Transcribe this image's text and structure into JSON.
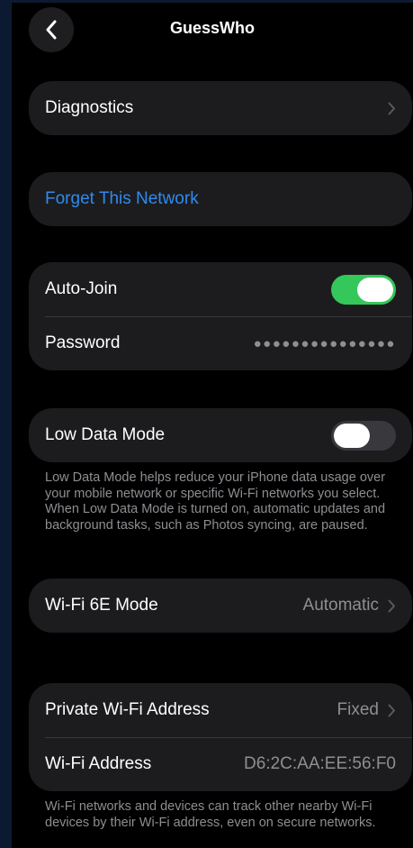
{
  "header": {
    "title": "GuessWho"
  },
  "diagnostics": {
    "label": "Diagnostics"
  },
  "forget": {
    "label": "Forget This Network"
  },
  "autojoin": {
    "label": "Auto-Join",
    "enabled": true
  },
  "password": {
    "label": "Password",
    "value": "●●●●●●●●●●●●●●●"
  },
  "low_data": {
    "label": "Low Data Mode",
    "enabled": false,
    "footnote": "Low Data Mode helps reduce your iPhone data usage over your mobile network or specific Wi-Fi networks you select. When Low Data Mode is turned on, automatic updates and background tasks, such as Photos syncing, are paused."
  },
  "wifi6e": {
    "label": "Wi-Fi 6E Mode",
    "value": "Automatic"
  },
  "private_address": {
    "label": "Private Wi-Fi Address",
    "value": "Fixed"
  },
  "wifi_address": {
    "label": "Wi-Fi Address",
    "value": "D6:2C:AA:EE:56:F0"
  },
  "address_footnote": "Wi-Fi networks and devices can track other nearby Wi-Fi devices by their Wi-Fi address, even on secure networks.",
  "colors": {
    "accent_blue": "#2e8bf0",
    "toggle_on": "#34c759",
    "toggle_off": "#39393d",
    "card_bg": "#1c1c1e"
  }
}
